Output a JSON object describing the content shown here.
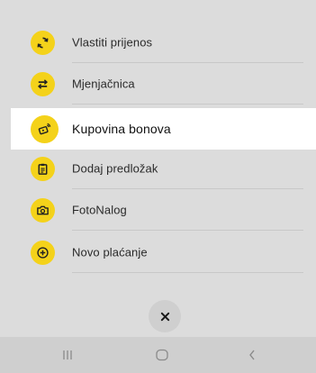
{
  "menu": {
    "items": [
      {
        "label": "Vlastiti prijenos",
        "icon": "refresh-arrows-icon"
      },
      {
        "label": "Mjenjačnica",
        "icon": "exchange-arrows-icon"
      },
      {
        "label": "Kupovina bonova",
        "icon": "mobile-voucher-icon",
        "active": true
      },
      {
        "label": "Dodaj predložak",
        "icon": "clipboard-icon"
      },
      {
        "label": "FotoNalog",
        "icon": "camera-icon"
      },
      {
        "label": "Novo plaćanje",
        "icon": "plus-circle-icon"
      }
    ]
  },
  "close": {
    "icon": "close-icon"
  },
  "navbar": {
    "recents_icon": "recents-icon",
    "home_icon": "home-icon",
    "back_icon": "back-icon"
  },
  "colors": {
    "accent": "#f4d21a",
    "sheet_background": "#dcdcdc",
    "active_row": "#ffffff"
  }
}
